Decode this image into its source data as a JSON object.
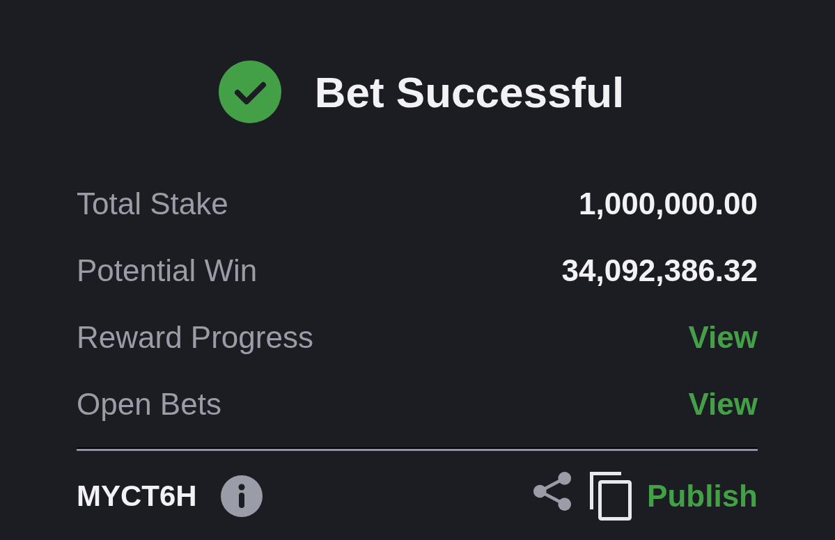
{
  "header": {
    "title": "Bet Successful"
  },
  "rows": [
    {
      "kind": "value",
      "label": "Total Stake",
      "value": "1,000,000.00"
    },
    {
      "kind": "value",
      "label": "Potential Win",
      "value": "34,092,386.32"
    },
    {
      "kind": "link",
      "label": "Reward Progress",
      "value": "View"
    },
    {
      "kind": "link",
      "label": "Open Bets",
      "value": "View"
    }
  ],
  "footer": {
    "code": "MYCT6H",
    "action": "Publish"
  }
}
